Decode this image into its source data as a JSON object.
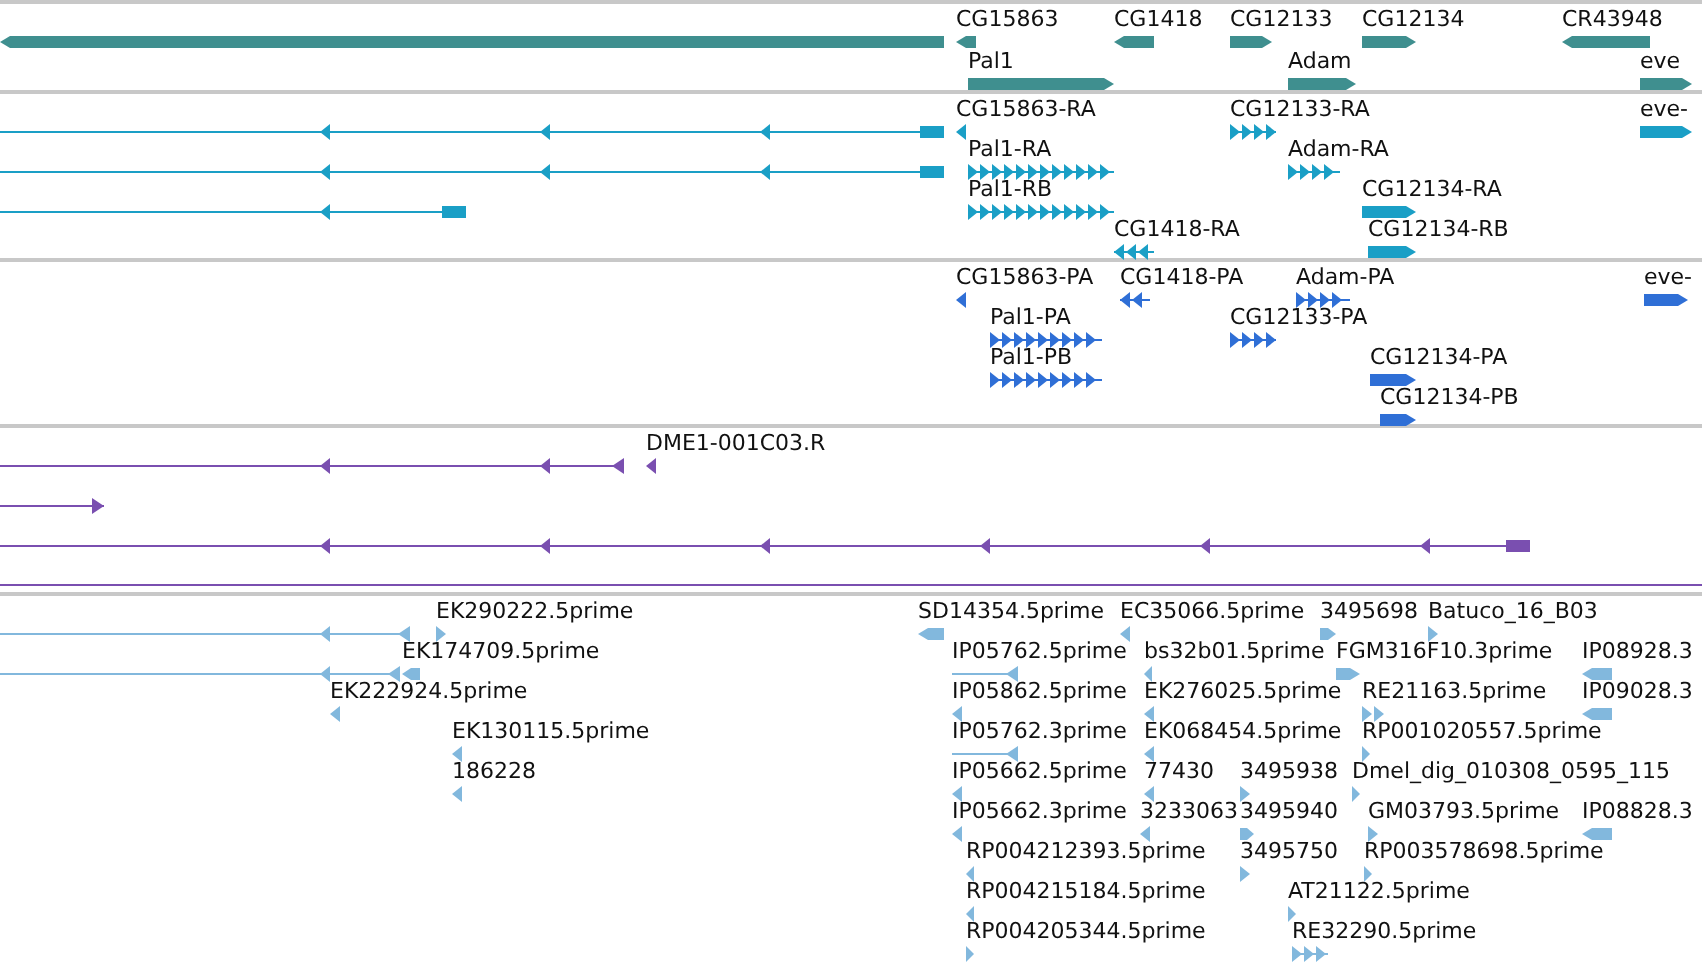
{
  "tracks": [
    {
      "kind": "gene",
      "features": [
        {
          "forward": false
        },
        {
          "label": "CG15863",
          "forward": false
        },
        {
          "label": "CG1418",
          "forward": false
        },
        {
          "label": "CG12133",
          "forward": true
        },
        {
          "label": "CG12134",
          "forward": true
        },
        {
          "label": "CR43948",
          "forward": false
        },
        {
          "label": "Pal1",
          "forward": true
        },
        {
          "label": "Adam",
          "forward": true
        },
        {
          "label": "eve",
          "forward": true
        }
      ]
    },
    {
      "kind": "mrna",
      "features": [
        {
          "forward": false
        },
        {
          "label": "CG15863-RA",
          "forward": false
        },
        {
          "label": "CG12133-RA",
          "forward": true
        },
        {
          "label": "eve-",
          "forward": true
        },
        {
          "forward": false
        },
        {
          "label": "Pal1-RA",
          "forward": true
        },
        {
          "label": "Adam-RA",
          "forward": true
        },
        {
          "forward": false
        },
        {
          "label": "Pal1-RB",
          "forward": true
        },
        {
          "label": "CG12134-RA",
          "forward": true
        },
        {
          "label": "CG1418-RA",
          "forward": false
        },
        {
          "label": "CG12134-RB",
          "forward": true
        }
      ]
    },
    {
      "kind": "protein",
      "features": [
        {
          "label": "CG15863-PA",
          "forward": false
        },
        {
          "label": "CG1418-PA",
          "forward": false
        },
        {
          "label": "Adam-PA",
          "forward": true
        },
        {
          "label": "eve-",
          "forward": true
        },
        {
          "label": "Pal1-PA",
          "forward": true
        },
        {
          "label": "CG12133-PA",
          "forward": true
        },
        {
          "label": "Pal1-PB",
          "forward": true
        },
        {
          "label": "CG12134-PA",
          "forward": true
        },
        {
          "label": "CG12134-PB",
          "forward": true
        }
      ]
    },
    {
      "kind": "cdna",
      "features": [
        {
          "forward": false
        },
        {
          "label": "DME1-001C03.R",
          "forward": false
        },
        {
          "forward": true
        },
        {
          "forward": false
        }
      ]
    },
    {
      "kind": "est",
      "features": [
        {
          "forward": false
        },
        {
          "label": "EK290222.5prime",
          "forward": true
        },
        {
          "label": "SD14354.5prime",
          "forward": false
        },
        {
          "label": "EC35066.5prime",
          "forward": false
        },
        {
          "label": "3495698",
          "forward": true
        },
        {
          "label": "Batuco_16_B03",
          "forward": true
        },
        {
          "forward": false
        },
        {
          "label": "EK174709.5prime",
          "forward": false
        },
        {
          "label": "IP05762.5prime",
          "forward": false
        },
        {
          "label": "bs32b01.5prime",
          "forward": false
        },
        {
          "label": "FGM316F10.3prime",
          "forward": true
        },
        {
          "label": "IP08928.3",
          "forward": false
        },
        {
          "label": "EK222924.5prime",
          "forward": false
        },
        {
          "label": "IP05862.5prime",
          "forward": false
        },
        {
          "label": "EK276025.5prime",
          "forward": false
        },
        {
          "label": "RE21163.5prime",
          "forward": true
        },
        {
          "label": "IP09028.3",
          "forward": false
        },
        {
          "label": "EK130115.5prime",
          "forward": false
        },
        {
          "label": "IP05762.3prime",
          "forward": false
        },
        {
          "label": "EK068454.5prime",
          "forward": false
        },
        {
          "label": "RP001020557.5prime",
          "forward": true
        },
        {
          "label": "186228",
          "forward": false
        },
        {
          "label": "IP05662.5prime",
          "forward": false
        },
        {
          "label": "77430",
          "forward": false
        },
        {
          "label": "3495938",
          "forward": true
        },
        {
          "label": "Dmel_dig_010308_0595_115",
          "forward": true
        },
        {
          "label": "IP05662.3prime",
          "forward": false
        },
        {
          "label": "3233063",
          "forward": false
        },
        {
          "label": "3495940",
          "forward": true
        },
        {
          "label": "GM03793.5prime",
          "forward": true
        },
        {
          "label": "IP08828.3",
          "forward": false
        },
        {
          "label": "RP004212393.5prime",
          "forward": false
        },
        {
          "label": "3495750",
          "forward": true
        },
        {
          "label": "RP003578698.5prime",
          "forward": true
        },
        {
          "label": "RP004215184.5prime",
          "forward": false
        },
        {
          "label": "AT21122.5prime",
          "forward": true
        },
        {
          "label": "RP004205344.5prime",
          "forward": true
        },
        {
          "label": "RE32290.5prime",
          "forward": true
        }
      ]
    }
  ]
}
